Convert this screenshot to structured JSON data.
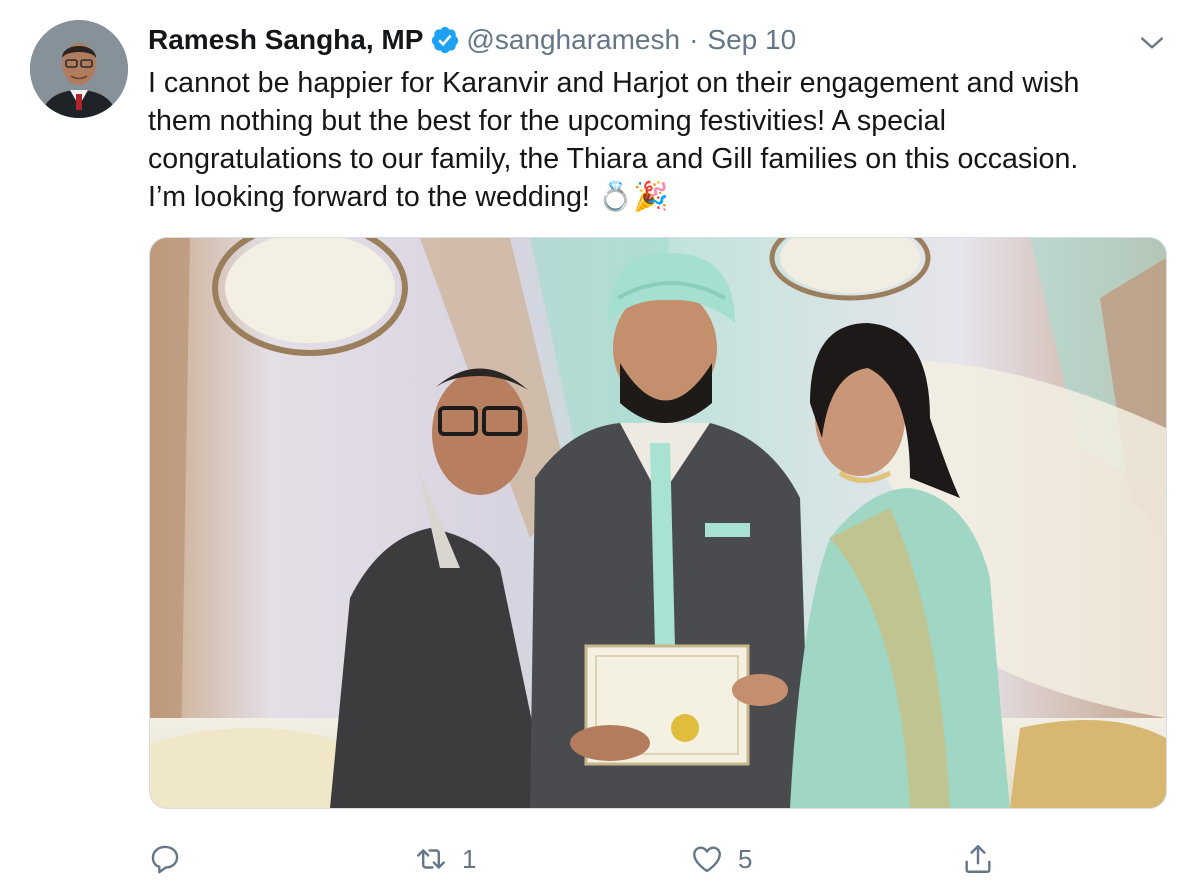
{
  "tweet": {
    "author_name": "Ramesh Sangha, MP",
    "handle": "@sangharamesh",
    "separator": "·",
    "date": "Sep 10",
    "text": "I cannot be happier for Karanvir and Harjot on their engagement and wish\nthem nothing but the best for the upcoming festivities! A special\ncongratulations to our family, the Thiara and Gill families on this occasion.\nI’m looking forward to the wedding! 💍🎉",
    "verified": true
  },
  "actions": {
    "reply_count": "",
    "retweet_count": "1",
    "like_count": "5"
  },
  "icons": {
    "verified": "verified-badge-icon",
    "caret": "chevron-down-icon",
    "reply": "reply-icon",
    "retweet": "retweet-icon",
    "like": "heart-icon",
    "share": "share-icon"
  },
  "colors": {
    "text": "#14171a",
    "secondary": "#657786",
    "verified": "#1da1f2"
  }
}
